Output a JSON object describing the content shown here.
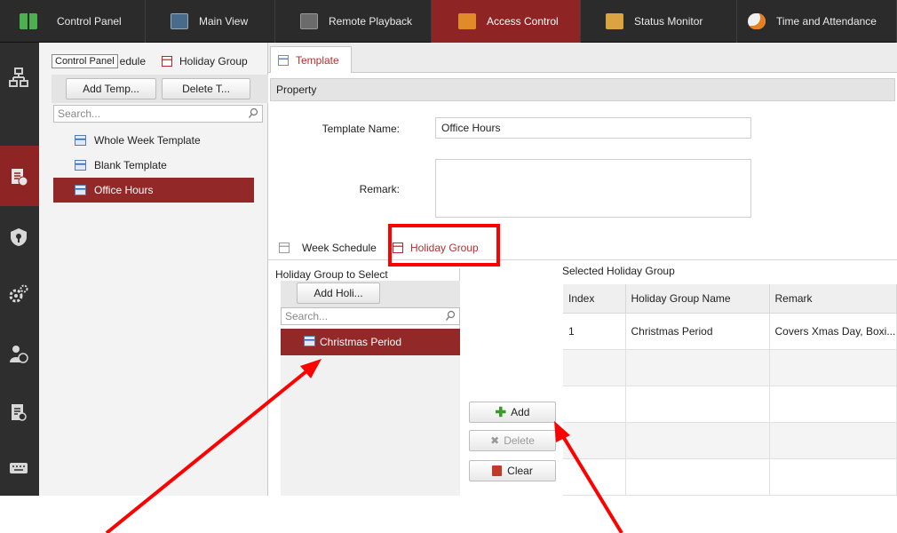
{
  "topbar": {
    "items": [
      {
        "label": "Control Panel",
        "icon": "control-panel-icon"
      },
      {
        "label": "Main View",
        "icon": "main-view-icon"
      },
      {
        "label": "Remote Playback",
        "icon": "remote-playback-icon"
      },
      {
        "label": "Access Control",
        "icon": "access-control-icon",
        "active": true
      },
      {
        "label": "Status Monitor",
        "icon": "status-monitor-icon"
      },
      {
        "label": "Time and Attendance",
        "icon": "time-attendance-icon"
      }
    ]
  },
  "rail": {
    "icons": [
      "device-tree-icon",
      "access-control-icon",
      "security-icon",
      "settings-gears-icon",
      "person-fingerprint-icon",
      "search-record-icon",
      "keyboard-icon"
    ],
    "active_index": 1
  },
  "left_panel": {
    "tooltip": "Control Panel",
    "tabs": {
      "schedule_partial": "edule",
      "holiday_group": "Holiday Group"
    },
    "buttons": {
      "add": "Add Temp...",
      "delete": "Delete T..."
    },
    "search_placeholder": "Search...",
    "templates": [
      {
        "label": "Whole Week Template"
      },
      {
        "label": "Blank Template"
      },
      {
        "label": "Office Hours",
        "selected": true
      }
    ]
  },
  "main": {
    "tab": "Template",
    "property_header": "Property",
    "template_name_label": "Template Name:",
    "template_name_value": "Office Hours",
    "remark_label": "Remark:",
    "remark_value": "",
    "inner_tabs": {
      "week_schedule": "Week Schedule",
      "holiday_group": "Holiday Group"
    },
    "holiday_select": {
      "title": "Holiday Group to Select",
      "add_button": "Add Holi...",
      "search_placeholder": "Search...",
      "items": [
        {
          "label": "Christmas Period",
          "selected": true
        }
      ]
    },
    "actions": {
      "add": "Add",
      "delete": "Delete",
      "clear": "Clear"
    },
    "selected_group": {
      "title": "Selected Holiday Group",
      "columns": [
        "Index",
        "Holiday Group Name",
        "Remark"
      ],
      "rows": [
        {
          "index": "1",
          "name": "Christmas Period",
          "remark": "Covers Xmas Day, Boxi..."
        }
      ]
    }
  },
  "colors": {
    "accent": "#922828",
    "topbar": "#2b2b2b",
    "highlight_box": "#ff0000"
  }
}
